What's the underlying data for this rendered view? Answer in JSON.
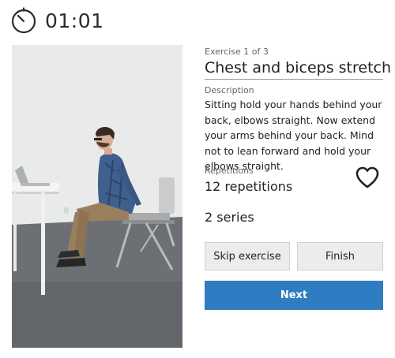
{
  "timer": {
    "icon": "stopwatch-icon",
    "time": "01:01"
  },
  "exercise": {
    "counter": "Exercise 1 of 3",
    "title": "Chest and biceps stretch",
    "description_label": "Description",
    "description": "Sitting hold your hands behind your back, elbows straight. Now extend your arms behind your back. Mind not to lean forward and hold your elbows straight.",
    "repetitions_label": "Repetitions",
    "repetitions": "12 repetitions",
    "series": "2 series",
    "favorite_icon": "heart-outline-icon"
  },
  "actions": {
    "skip_label": "Skip exercise",
    "finish_label": "Finish",
    "next_label": "Next"
  },
  "colors": {
    "primary": "#2f7cc2",
    "secondary_button": "#ececec",
    "text": "#222222",
    "muted": "#666666"
  }
}
